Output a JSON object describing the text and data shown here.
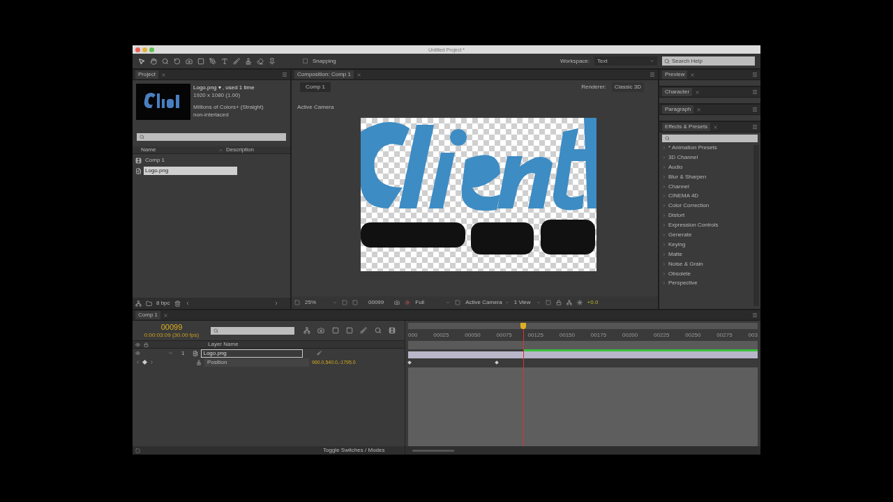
{
  "window": {
    "title": "Untitled Project *"
  },
  "toolbar": {
    "snapping": "Snapping",
    "snapping_checked": false,
    "workspace_label": "Workspace:",
    "workspace": "Text",
    "search_placeholder": "Search Help"
  },
  "project": {
    "tab": "Project",
    "file_name": "Logo.png ▾ , used 1 time",
    "info": [
      "1920 x 1080 (1.00)",
      "Millions of Colors+ (Straight)",
      "non-interlaced"
    ],
    "columns": [
      "Name",
      "Description"
    ],
    "items": [
      {
        "kind": "comp",
        "name": "Comp 1",
        "selected": false
      },
      {
        "kind": "footage",
        "name": "Logo.png",
        "selected": true
      }
    ],
    "bpc": "8 bpc"
  },
  "composition": {
    "tab": "Composition: Comp 1",
    "subtab": "Comp 1",
    "renderer_label": "Renderer:",
    "renderer": "Classic 3D",
    "view_label": "Active Camera",
    "zoom": "25%",
    "timecode": "00099",
    "resolution": "Full",
    "camera": "Active Camera",
    "views": "1 View",
    "exposure": "+0.0"
  },
  "panels": [
    {
      "title": "Preview"
    },
    {
      "title": "Character"
    },
    {
      "title": "Paragraph"
    }
  ],
  "effects": {
    "title": "Effects & Presets",
    "items": [
      "* Animation Presets",
      "3D Channel",
      "Audio",
      "Blur & Sharpen",
      "Channel",
      "CINEMA 4D",
      "Color Correction",
      "Distort",
      "Expression Controls",
      "Generate",
      "Keying",
      "Matte",
      "Noise & Grain",
      "Obsolete",
      "Perspective"
    ]
  },
  "timeline": {
    "tab": "Comp 1",
    "timecode": "00099",
    "timecode_detail": "0:00:03:09 (30.00 fps)",
    "column": "Layer Name",
    "ruler": [
      "000",
      "00025",
      "00050",
      "00075",
      "00125",
      "00150",
      "00175",
      "00200",
      "00225",
      "00250",
      "00275",
      "003"
    ],
    "playhead": {
      "level": 0.33
    },
    "layers": [
      {
        "number": "1",
        "name": "Logo.png",
        "selected": true
      }
    ],
    "property": {
      "name": "Position",
      "value": "960.0,540.0,-1795.0"
    },
    "footer": "Toggle Switches / Modes"
  }
}
